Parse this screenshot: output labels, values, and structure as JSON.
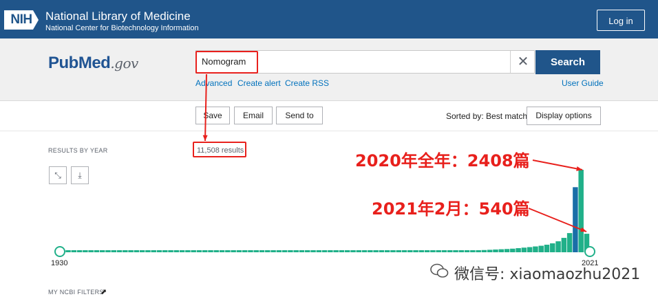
{
  "nih_header": {
    "logo_text": "NIH",
    "title": "National Library of Medicine",
    "subtitle": "National Center for Biotechnology Information",
    "login_label": "Log in"
  },
  "pubmed": {
    "logo_pub": "Pub",
    "logo_med": "Med",
    "logo_gov": ".gov"
  },
  "search": {
    "query": "Nomogram",
    "button_label": "Search",
    "links": [
      "Advanced",
      "Create alert",
      "Create RSS"
    ],
    "user_guide": "User Guide"
  },
  "actions": {
    "save": "Save",
    "email": "Email",
    "send_to": "Send to",
    "sorted_by": "Sorted by: Best match",
    "display_options": "Display options"
  },
  "results": {
    "section_label": "RESULTS BY YEAR",
    "count_text": "11,508 results",
    "start_year": "1930",
    "end_year": "2021",
    "ncbi_filters": "MY NCBI FILTERS"
  },
  "annotations": {
    "full_year": "2020年全年：2408篇",
    "feb_2021": "2021年2月：540篇"
  },
  "watermark": "微信号: xiaomaozhu2021",
  "colors": {
    "nih_blue": "#20558a",
    "bar_teal": "#20b089",
    "highlight_bar": "#1a6fa8",
    "annotation_red": "#e8201c"
  },
  "chart_data": {
    "type": "bar",
    "title": "RESULTS BY YEAR",
    "x_range": [
      1930,
      2021
    ],
    "highlighted_year": 2020,
    "values": [
      1,
      1,
      1,
      1,
      1,
      1,
      1,
      1,
      1,
      1,
      1,
      1,
      1,
      1,
      1,
      1,
      1,
      1,
      1,
      1,
      1,
      1,
      1,
      1,
      1,
      1,
      1,
      1,
      1,
      1,
      1,
      1,
      1,
      1,
      1,
      1,
      1,
      2,
      2,
      2,
      2,
      2,
      2,
      3,
      3,
      3,
      3,
      4,
      4,
      5,
      5,
      6,
      6,
      7,
      8,
      9,
      10,
      11,
      12,
      14,
      15,
      17,
      19,
      22,
      25,
      28,
      31,
      34,
      37,
      40,
      45,
      50,
      55,
      60,
      65,
      72,
      80,
      88,
      95,
      105,
      120,
      135,
      150,
      170,
      190,
      220,
      260,
      320,
      420,
      560,
      1900,
      2408,
      540
    ]
  }
}
